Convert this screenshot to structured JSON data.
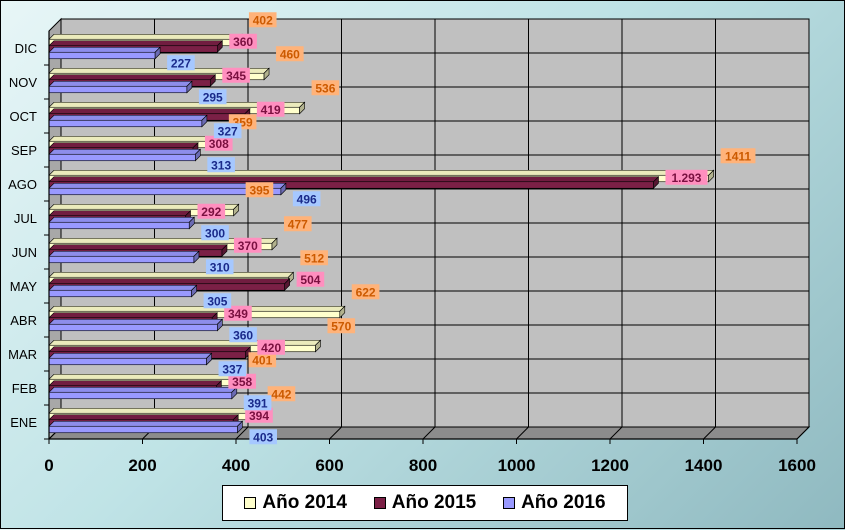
{
  "chart_data": {
    "type": "bar",
    "orientation": "horizontal",
    "categories": [
      "ENE",
      "FEB",
      "MAR",
      "ABR",
      "MAY",
      "JUN",
      "JUL",
      "AGO",
      "SEP",
      "OCT",
      "NOV",
      "DIC"
    ],
    "series": [
      {
        "name": "Año 2014",
        "color": "#ffffcc",
        "label_bg": "#ffb37a",
        "values": [
          442,
          401,
          570,
          622,
          512,
          477,
          395,
          1411,
          359,
          536,
          460,
          402
        ],
        "labels": [
          "442",
          "401",
          "570",
          "622",
          "512",
          "477",
          "395",
          "1411",
          "359",
          "536",
          "460",
          "402"
        ]
      },
      {
        "name": "Año 2015",
        "color": "#7b2046",
        "label_bg": "#ff8fbf",
        "values": [
          394,
          358,
          420,
          349,
          504,
          370,
          292,
          1293,
          308,
          419,
          345,
          360
        ],
        "labels": [
          "394",
          "358",
          "420",
          "349",
          "504",
          "370",
          "292",
          "1.293",
          "308",
          "419",
          "345",
          "360"
        ]
      },
      {
        "name": "Año 2016",
        "color": "#9999ff",
        "label_bg": "#a6c8ff",
        "values": [
          403,
          391,
          337,
          360,
          305,
          310,
          300,
          496,
          313,
          327,
          295,
          227
        ],
        "labels": [
          "403",
          "391",
          "337",
          "360",
          "305",
          "310",
          "300",
          "496",
          "313",
          "327",
          "295",
          "227"
        ]
      }
    ],
    "x_ticks": [
      "0",
      "200",
      "400",
      "600",
      "800",
      "1000",
      "1200",
      "1400",
      "1600"
    ],
    "xlim": [
      0,
      1600
    ],
    "grid": true,
    "legend_position": "bottom",
    "title": "",
    "xlabel": "",
    "ylabel": ""
  }
}
